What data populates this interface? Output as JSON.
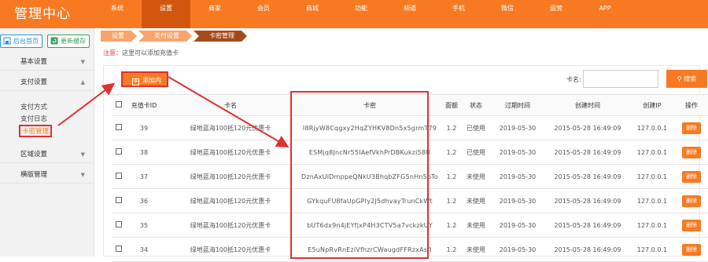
{
  "app": {
    "title": "管理中心"
  },
  "nav": [
    "系统",
    "设置",
    "商家",
    "会员",
    "商城",
    "功能",
    "频道",
    "手机",
    "微信",
    "运营",
    "APP"
  ],
  "nav_active": 1,
  "sidebar": {
    "home_label": "后台首页",
    "refresh_label": "更新缓存",
    "groups": [
      {
        "label": "基本设置",
        "arrow": "▼"
      },
      {
        "label": "支付设置",
        "arrow": "▲"
      },
      {
        "label": "区域设置",
        "arrow": "▼"
      },
      {
        "label": "横版管理",
        "arrow": "▼"
      }
    ],
    "subitems": [
      "支付方式",
      "支付日志",
      "卡密管理"
    ]
  },
  "breadcrumb": [
    "设置",
    "支付设置",
    "卡密管理"
  ],
  "notice": {
    "label": "注意：",
    "text": "这里可以添加充值卡"
  },
  "toolbar": {
    "add_label": "添加内容",
    "search_label": "卡名:",
    "search_button": "搜索"
  },
  "table": {
    "headers": [
      "",
      "充值卡ID",
      "卡名",
      "卡密",
      "面额",
      "状态",
      "过期时间",
      "创建时间",
      "创建IP",
      "操作"
    ],
    "rows": [
      {
        "id": "39",
        "name": "绿地蓝海100抵120元优惠卡",
        "key": "I8RjyW8Cqgxy2HqZYHKV8Dn5x5grmT79",
        "amount": "1.2",
        "status": "已使用",
        "expire": "2019-05-30",
        "created": "2015-05-28 16:49:09",
        "ip": "127.0.0.1",
        "action": "删除"
      },
      {
        "id": "38",
        "name": "绿地蓝海100抵120元优惠卡",
        "key": "ESMjq8JncNr55IAefVkhPrDBKukzi58U",
        "amount": "1.2",
        "status": "已使用",
        "expire": "2019-05-30",
        "created": "2015-05-28 16:49:09",
        "ip": "127.0.0.1",
        "action": "删除"
      },
      {
        "id": "37",
        "name": "绿地蓝海100抵120元优惠卡",
        "key": "DznAxUIDmppeQNkU3BhqbZFG5nHn5bTo",
        "amount": "1.2",
        "status": "未使用",
        "expire": "2019-05-30",
        "created": "2015-05-28 16:49:09",
        "ip": "127.0.0.1",
        "action": "删除"
      },
      {
        "id": "36",
        "name": "绿地蓝海100抵120元优惠卡",
        "key": "GYkquFU8faUpGPIy2J5dhvayTrunCkWt",
        "amount": "1.2",
        "status": "未使用",
        "expire": "2019-05-30",
        "created": "2015-05-28 16:49:09",
        "ip": "127.0.0.1",
        "action": "删除"
      },
      {
        "id": "35",
        "name": "绿地蓝海100抵120元优惠卡",
        "key": "bUT6dx9n4jEYfjxP4H3CTV5a7vckzkUY",
        "amount": "1.2",
        "status": "未使用",
        "expire": "2019-05-30",
        "created": "2015-05-28 16:49:09",
        "ip": "127.0.0.1",
        "action": "删除"
      },
      {
        "id": "34",
        "name": "绿地蓝海100抵120元优惠卡",
        "key": "E5uNpRvRnEziVfhzrCWaugdFFRzxAsfI",
        "amount": "1.2",
        "status": "未使用",
        "expire": "2019-05-30",
        "created": "2015-05-28 16:49:09",
        "ip": "127.0.0.1",
        "action": "删除"
      }
    ]
  },
  "colors": {
    "brand": "#f77a22",
    "nav_active": "#d2570e",
    "annotation": "#e03030",
    "link": "#2c8fd8",
    "refresh": "#35a35a"
  }
}
